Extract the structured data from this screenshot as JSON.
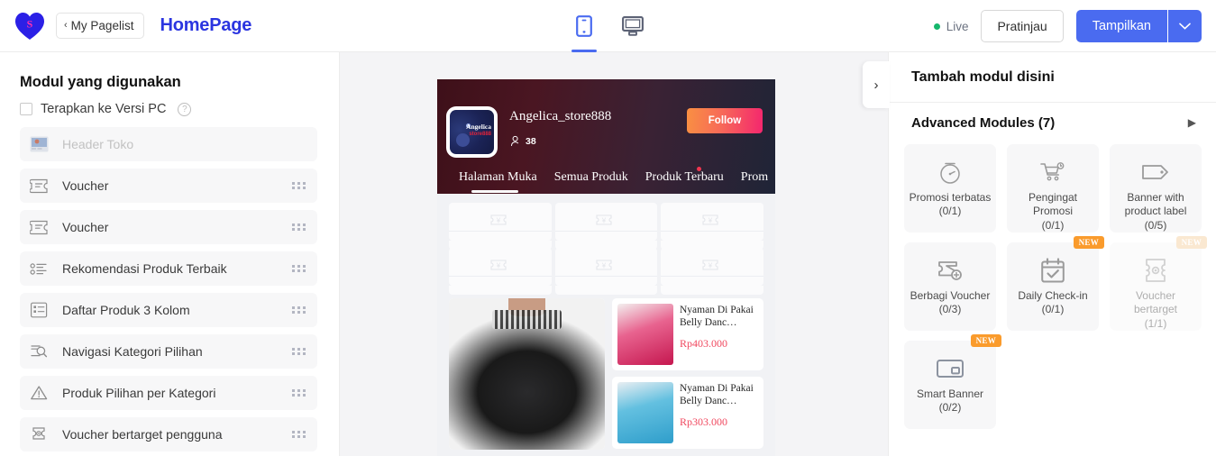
{
  "topbar": {
    "logo_icon": "heart-dollar-logo",
    "pagelist_label": "My Pagelist",
    "pagelist_chevron": "‹",
    "page_title": "HomePage",
    "device_mobile_icon": "mobile-device-icon",
    "device_desktop_icon": "desktop-device-icon",
    "live_label": "Live",
    "preview_label": "Pratinjau",
    "publish_label": "Tampilkan",
    "publish_caret": "⌄",
    "accent_blue": "#4a6bf0",
    "title_blue": "#2b35e0",
    "live_green": "#15b76c"
  },
  "left_panel": {
    "title": "Modul yang digunakan",
    "checkbox_label": "Terapkan ke Versi PC",
    "help_glyph": "?",
    "modules": [
      {
        "label": "Header Toko",
        "icon": "store-header-icon",
        "disabled": true,
        "draggable": false
      },
      {
        "label": "Voucher",
        "icon": "voucher-ticket-icon",
        "disabled": false,
        "draggable": true
      },
      {
        "label": "Voucher",
        "icon": "voucher-ticket-icon",
        "disabled": false,
        "draggable": true
      },
      {
        "label": "Rekomendasi Produk Terbaik",
        "icon": "list-bullet-icon",
        "disabled": false,
        "draggable": true
      },
      {
        "label": "Daftar Produk 3 Kolom",
        "icon": "list-grid-icon",
        "disabled": false,
        "draggable": true
      },
      {
        "label": "Navigasi Kategori Pilihan",
        "icon": "category-search-icon",
        "disabled": false,
        "draggable": true
      },
      {
        "label": "Produk Pilihan per Kategori",
        "icon": "warning-triangle-icon",
        "disabled": false,
        "draggable": true
      },
      {
        "label": "Voucher bertarget pengguna",
        "icon": "targeted-voucher-icon",
        "disabled": false,
        "draggable": true
      }
    ]
  },
  "preview": {
    "store_name": "Angelica_store888",
    "avatar_name": "Angelica",
    "avatar_sub": "store888",
    "follower_icon": "person-follower-icon",
    "follower_count": "38",
    "follow_button": "Follow",
    "nav_tabs": [
      {
        "label": "Halaman Muka",
        "active": true,
        "dot": false
      },
      {
        "label": "Semua Produk",
        "active": false,
        "dot": false
      },
      {
        "label": "Produk Terbaru",
        "active": false,
        "dot": true
      },
      {
        "label": "Prom",
        "active": false,
        "dot": false
      }
    ],
    "voucher_placeholder_icon": "voucher-empty-icon",
    "voucher_rows": 2,
    "voucher_cols": 3,
    "big_product_alt": "black belly dance skirt",
    "products": [
      {
        "title": "Nyaman Di Pakai Belly Danc…",
        "price": "Rp403.000",
        "thumb": "pink"
      },
      {
        "title": "Nyaman Di Pakai Belly Danc…",
        "price": "Rp303.000",
        "thumb": "blue"
      }
    ]
  },
  "right_panel": {
    "collapse_chevron": "›",
    "header": "Tambah modul disini",
    "section_title": "Advanced Modules (7)",
    "section_caret": "▶",
    "new_badge": "NEW",
    "tiles": [
      {
        "label": "Promosi terbatas",
        "count": "(0/1)",
        "icon": "timer-icon",
        "new": false,
        "disabled": false
      },
      {
        "label": "Pengingat Promosi",
        "count": "(0/1)",
        "icon": "cart-reminder-icon",
        "new": false,
        "disabled": false
      },
      {
        "label": "Banner with product label",
        "count": "(0/5)",
        "icon": "price-tag-icon",
        "new": false,
        "disabled": false
      },
      {
        "label": "Berbagi Voucher",
        "count": "(0/3)",
        "icon": "share-voucher-icon",
        "new": false,
        "disabled": false
      },
      {
        "label": "Daily Check-in",
        "count": "(0/1)",
        "icon": "calendar-check-icon",
        "new": true,
        "disabled": false
      },
      {
        "label": "Voucher bertarget",
        "count": "(1/1)",
        "icon": "targeted-voucher-icon",
        "new": true,
        "disabled": true
      },
      {
        "label": "Smart Banner",
        "count": "(0/2)",
        "icon": "smart-banner-icon",
        "new": true,
        "disabled": false
      }
    ]
  }
}
